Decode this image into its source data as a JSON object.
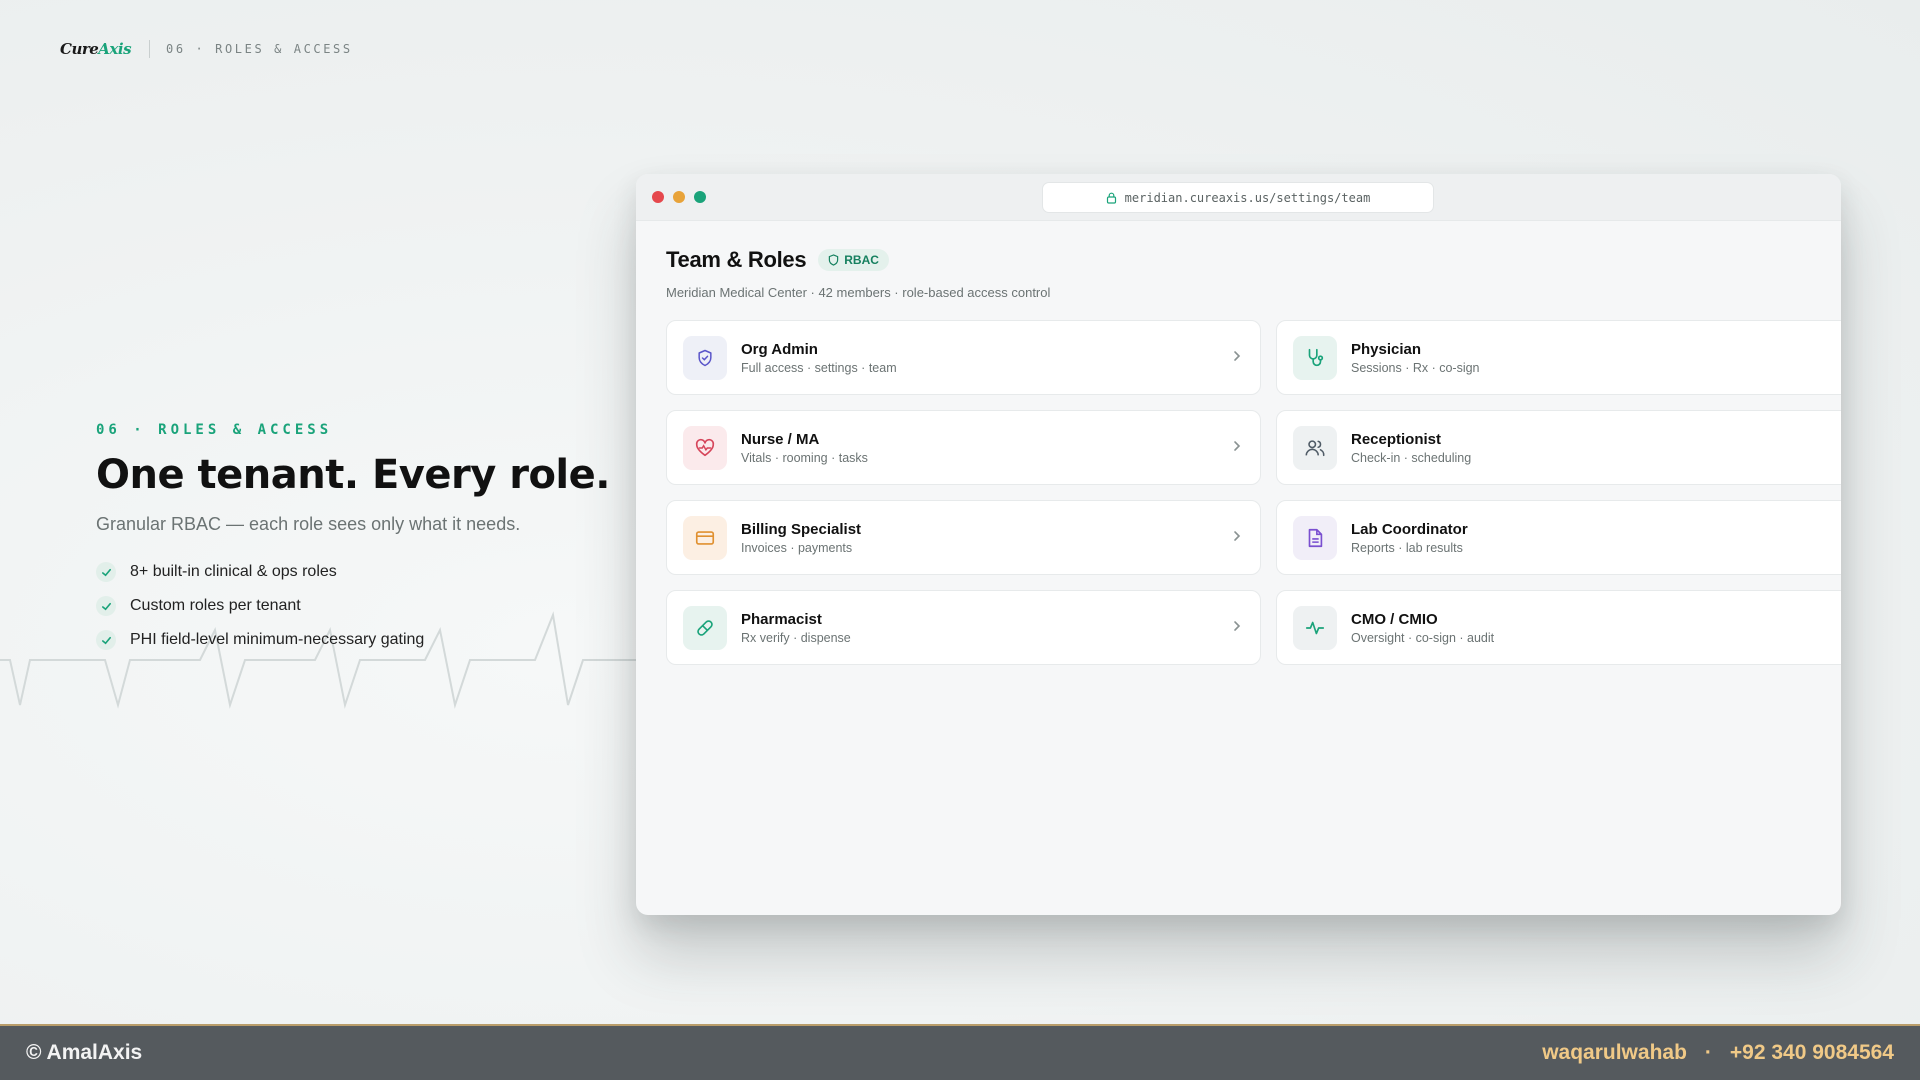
{
  "brand": {
    "logo_cure": "Cure",
    "logo_axis": "Axis",
    "kicker": "06 · ROLES & ACCESS"
  },
  "hero": {
    "kicker": "06 · ROLES & ACCESS",
    "headline": "One tenant. Every role.",
    "subtitle": "Granular RBAC — each role sees only what it needs.",
    "bullets": [
      "8+ built-in clinical & ops roles",
      "Custom roles per tenant",
      "PHI field-level minimum-necessary gating"
    ]
  },
  "browser": {
    "url": "meridian.cureaxis.us/settings/team"
  },
  "page": {
    "title": "Team & Roles",
    "badge": "RBAC",
    "meta": "Meridian Medical Center · 42 members · role-based access control"
  },
  "roles": [
    {
      "name": "Org Admin",
      "desc": "Full access · settings · team",
      "icon": "shield-check-icon"
    },
    {
      "name": "Physician",
      "desc": "Sessions · Rx · co-sign",
      "icon": "stethoscope-icon"
    },
    {
      "name": "Nurse / MA",
      "desc": "Vitals · rooming · tasks",
      "icon": "heart-pulse-icon"
    },
    {
      "name": "Receptionist",
      "desc": "Check-in · scheduling",
      "icon": "users-icon"
    },
    {
      "name": "Billing Specialist",
      "desc": "Invoices · payments",
      "icon": "credit-card-icon"
    },
    {
      "name": "Lab Coordinator",
      "desc": "Reports · lab results",
      "icon": "document-icon"
    },
    {
      "name": "Pharmacist",
      "desc": "Rx verify · dispense",
      "icon": "pill-icon"
    },
    {
      "name": "CMO / CMIO",
      "desc": "Oversight · co-sign · audit",
      "icon": "activity-icon"
    }
  ],
  "colors": {
    "accent": "#1aa37a",
    "footer_bg": "#555a5e",
    "footer_accent": "#f0c987"
  },
  "footer": {
    "copyright": "© AmalAxis",
    "author": "waqarulwahab",
    "separator": "·",
    "phone": "+92 340 9084564"
  }
}
